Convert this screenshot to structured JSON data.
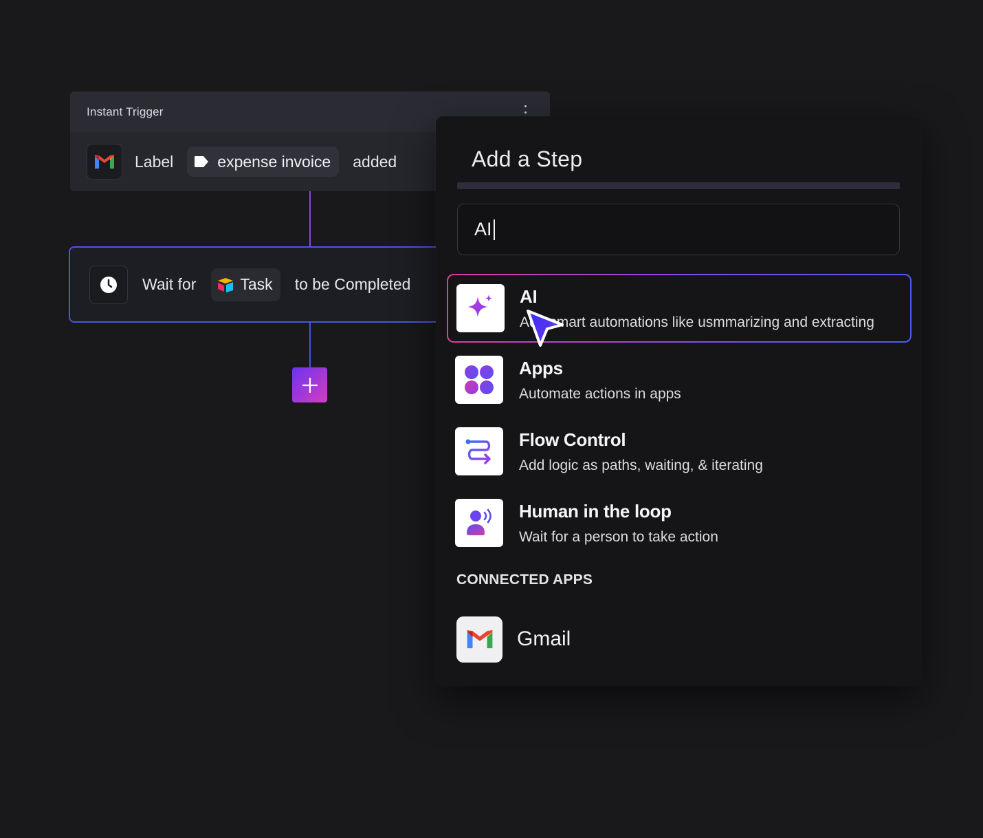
{
  "trigger": {
    "title": "Instant Trigger",
    "label_text": "Label",
    "label_chip": "expense invoice",
    "suffix": "added",
    "app_icon": "gmail-icon"
  },
  "wait": {
    "prefix": "Wait for",
    "chip": "Task",
    "suffix": "to be Completed",
    "icon": "clock-icon",
    "chip_icon": "airtable-icon"
  },
  "add_button": {
    "icon": "plus-icon"
  },
  "panel": {
    "title": "Add a Step",
    "search_value": "AI",
    "options": [
      {
        "title": "AI",
        "description": "Add smart automations like usmmarizing and extracting",
        "icon": "sparkle-icon",
        "selected": true
      },
      {
        "title": "Apps",
        "description": "Automate actions in apps",
        "icon": "apps-grid-icon"
      },
      {
        "title": "Flow Control",
        "description": "Add logic as paths, waiting, & iterating",
        "icon": "flow-route-icon"
      },
      {
        "title": "Human in the loop",
        "description": "Wait for a person to take action",
        "icon": "person-voice-icon"
      }
    ],
    "connected_label": "CONNECTED APPS",
    "connected_apps": [
      {
        "name": "Gmail",
        "icon": "gmail-icon"
      }
    ]
  },
  "colors": {
    "background": "#19191c",
    "accent_purple": "#8a49d8",
    "accent_blue": "#4a55e0",
    "accent_pink": "#e13c9a"
  }
}
